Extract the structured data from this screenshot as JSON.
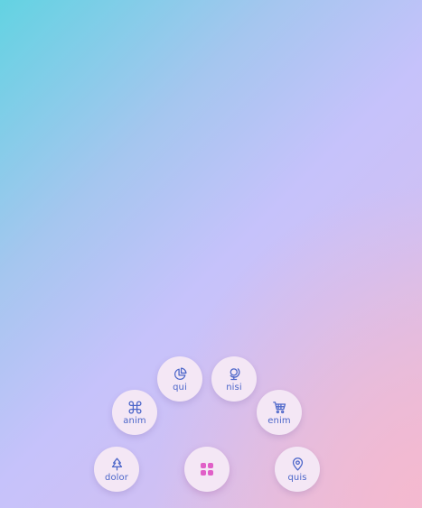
{
  "menu": {
    "main_icon": "grid-icon",
    "accent_color": "#4c66c9",
    "main_icon_color": "#e05fc7",
    "items": [
      {
        "label": "dolor",
        "icon": "tree-icon"
      },
      {
        "label": "anim",
        "icon": "command-icon"
      },
      {
        "label": "qui",
        "icon": "pie-chart-icon"
      },
      {
        "label": "nisi",
        "icon": "globe-icon"
      },
      {
        "label": "enim",
        "icon": "shopping-cart-icon"
      },
      {
        "label": "quis",
        "icon": "map-pin-icon"
      }
    ]
  }
}
